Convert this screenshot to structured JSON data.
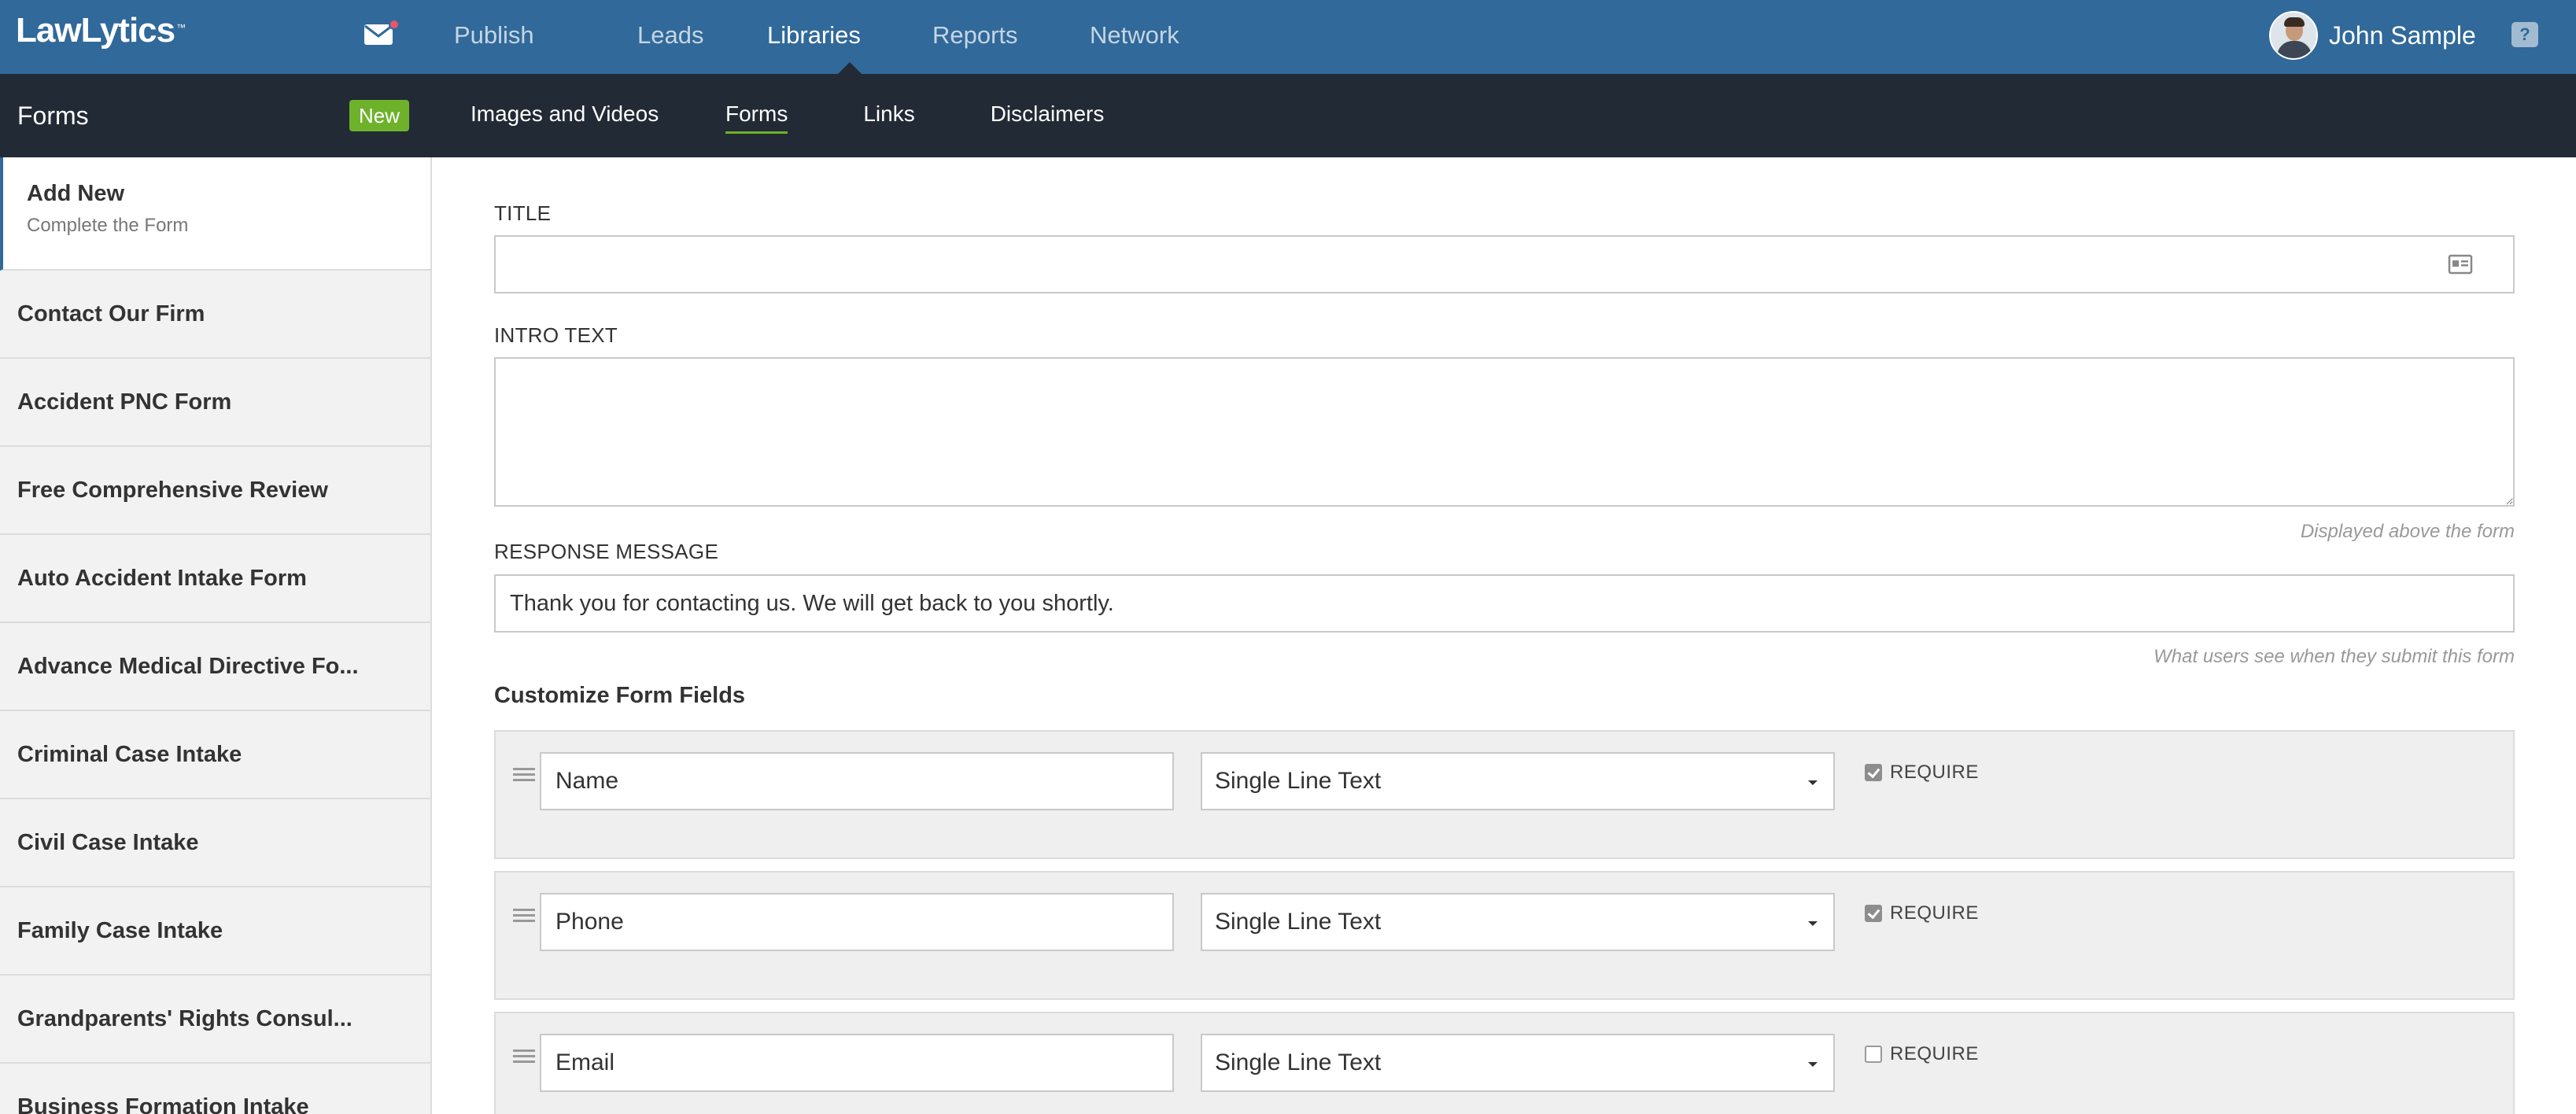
{
  "app": {
    "logo": "LawLytics",
    "logo_tm": "™",
    "mail_icon": "envelope-icon",
    "notification_color": "#e8576a",
    "brand_color": "#30699a",
    "accent_color": "#6eb22b"
  },
  "topnav": {
    "items": [
      {
        "label": "Publish"
      },
      {
        "label": "Leads"
      },
      {
        "label": "Libraries",
        "active": true
      },
      {
        "label": "Reports"
      },
      {
        "label": "Network"
      }
    ]
  },
  "user": {
    "name": "John Sample",
    "help_label": "?"
  },
  "subbar": {
    "section_title": "Forms",
    "new_badge": "New",
    "items": [
      {
        "label": "Images and Videos"
      },
      {
        "label": "Forms",
        "active": true
      },
      {
        "label": "Links"
      },
      {
        "label": "Disclaimers"
      }
    ]
  },
  "sidebar": {
    "add_new_title": "Add New",
    "add_new_subtitle": "Complete the Form",
    "items": [
      {
        "label": "Contact Our Firm"
      },
      {
        "label": "Accident PNC Form"
      },
      {
        "label": "Free Comprehensive Review"
      },
      {
        "label": "Auto Accident Intake Form"
      },
      {
        "label": "Advance Medical Directive Fo..."
      },
      {
        "label": "Criminal Case Intake"
      },
      {
        "label": "Civil Case Intake"
      },
      {
        "label": "Family Case Intake"
      },
      {
        "label": "Grandparents' Rights Consul..."
      },
      {
        "label": "Business Formation Intake"
      }
    ]
  },
  "form": {
    "title_label": "TITLE",
    "title_value": "",
    "intro_label": "INTRO TEXT",
    "intro_value": "",
    "intro_hint": "Displayed above the form",
    "response_label": "RESPONSE MESSAGE",
    "response_value": "Thank you for contacting us.  We will get back to you shortly.",
    "response_hint": "What users see when they submit this form",
    "customize_title": "Customize Form Fields",
    "require_label": "REQUIRE",
    "fields": [
      {
        "name": "Name",
        "type": "Single Line Text",
        "required": true
      },
      {
        "name": "Phone",
        "type": "Single Line Text",
        "required": true
      },
      {
        "name": "Email",
        "type": "Single Line Text",
        "required": false
      }
    ]
  }
}
